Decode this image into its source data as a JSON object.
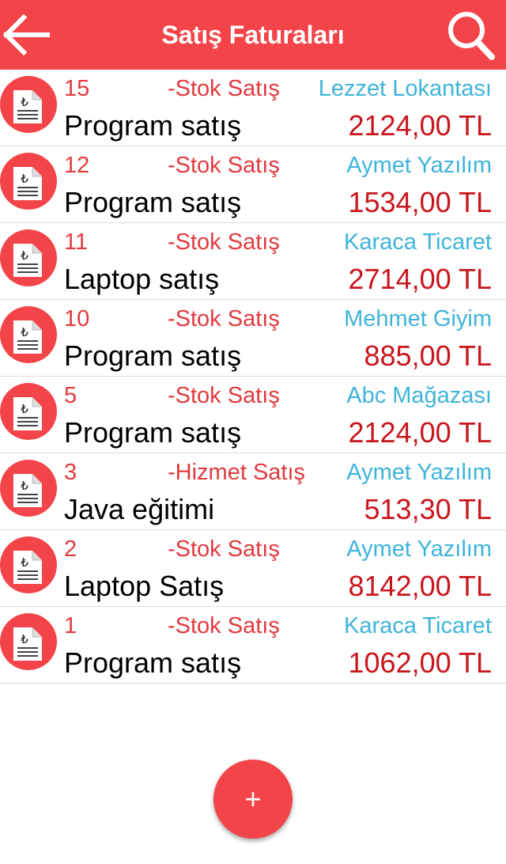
{
  "header": {
    "title": "Satış Faturaları",
    "back_icon": "back-arrow-icon",
    "search_icon": "search-icon",
    "color": "#f34449"
  },
  "invoices": [
    {
      "number": "15",
      "type": "-Stok Satış",
      "customer": "Lezzet Lokantası",
      "description": "Program satış",
      "amount": "2124,00 TL"
    },
    {
      "number": "12",
      "type": "-Stok Satış",
      "customer": "Aymet Yazılım",
      "description": "Program satış",
      "amount": "1534,00 TL"
    },
    {
      "number": "11",
      "type": "-Stok Satış",
      "customer": "Karaca Ticaret",
      "description": "Laptop satış",
      "amount": "2714,00 TL"
    },
    {
      "number": "10",
      "type": "-Stok Satış",
      "customer": "Mehmet  Giyim",
      "description": "Program satış",
      "amount": "885,00 TL"
    },
    {
      "number": "5",
      "type": "-Stok Satış",
      "customer": "Abc Mağazası",
      "description": "Program satış",
      "amount": "2124,00 TL"
    },
    {
      "number": "3",
      "type": "-Hizmet Satış",
      "customer": "Aymet Yazılım",
      "description": "Java eğitimi",
      "amount": "513,30 TL"
    },
    {
      "number": "2",
      "type": "-Stok Satış",
      "customer": "Aymet Yazılım",
      "description": "Laptop Satış",
      "amount": "8142,00 TL"
    },
    {
      "number": "1",
      "type": "-Stok Satış",
      "customer": "Karaca Ticaret",
      "description": "Program satış",
      "amount": "1062,00 TL"
    }
  ],
  "invoice_icon": "lira-invoice-icon",
  "fab": {
    "label": "+",
    "icon": "add-icon"
  }
}
